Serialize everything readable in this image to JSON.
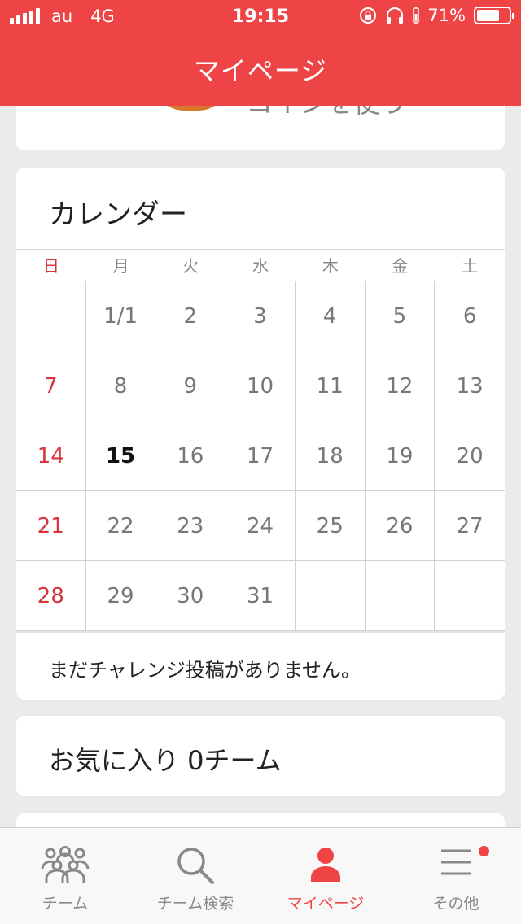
{
  "status_bar": {
    "carrier": "au",
    "network": "4G",
    "time": "19:15",
    "battery": "71%",
    "battery_level": 0.71
  },
  "header": {
    "title": "マイページ"
  },
  "top_card": {
    "peek_text": "コインを使う"
  },
  "calendar": {
    "title": "カレンダー",
    "weekdays": [
      "日",
      "月",
      "火",
      "水",
      "木",
      "金",
      "土"
    ],
    "weeks": [
      [
        "",
        "1/1",
        "2",
        "3",
        "4",
        "5",
        "6"
      ],
      [
        "7",
        "8",
        "9",
        "10",
        "11",
        "12",
        "13"
      ],
      [
        "14",
        "15",
        "16",
        "17",
        "18",
        "19",
        "20"
      ],
      [
        "21",
        "22",
        "23",
        "24",
        "25",
        "26",
        "27"
      ],
      [
        "28",
        "29",
        "30",
        "31",
        "",
        "",
        ""
      ]
    ],
    "today": "15",
    "empty_message": "まだチャレンジ投稿がありません。"
  },
  "favorites": {
    "label": "お気に入り 0チーム"
  },
  "tabbar": {
    "items": [
      {
        "label": "チーム",
        "icon": "team-icon"
      },
      {
        "label": "チーム検索",
        "icon": "search-icon"
      },
      {
        "label": "マイページ",
        "icon": "person-icon"
      },
      {
        "label": "その他",
        "icon": "menu-icon"
      }
    ],
    "active_index": 2
  },
  "colors": {
    "brand": "#ef4446",
    "sunday": "#d6333c"
  }
}
